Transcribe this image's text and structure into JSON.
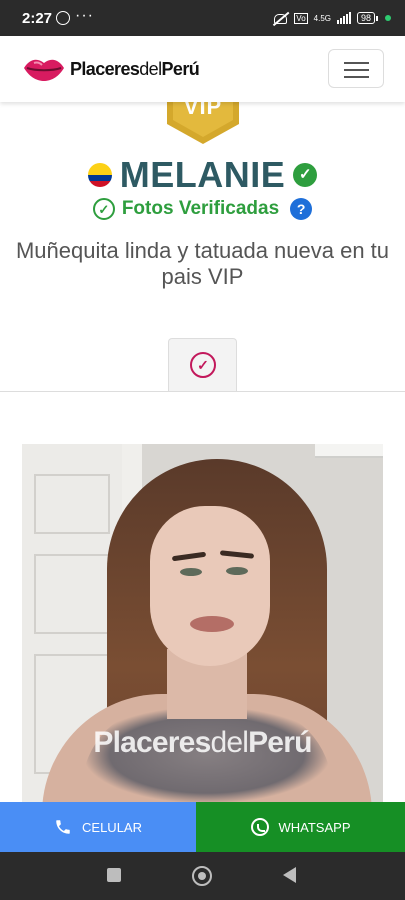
{
  "status_bar": {
    "time": "2:27",
    "network_label": "4.5G",
    "volte_label": "Vo",
    "battery": "98"
  },
  "header": {
    "brand_part1": "Placeres",
    "brand_part2": "del",
    "brand_part3": "Perú",
    "menu_icon": "hamburger-icon"
  },
  "profile": {
    "badge": "VIP",
    "name": "MELANIE",
    "flag_country": "Colombia",
    "flag_colors": [
      "#fcd116",
      "#003893",
      "#ce1126"
    ],
    "verified_label": "Fotos Verificadas",
    "help_symbol": "?",
    "description": "Muñequita linda y tatuada nueva en tu pais VIP"
  },
  "tabs": [
    {
      "icon": "check-circle-icon",
      "active": true
    }
  ],
  "photo": {
    "watermark_part1": "Placeres",
    "watermark_part2": "del",
    "watermark_part3": "Perú"
  },
  "actions": {
    "call_label": "CELULAR",
    "whatsapp_label": "WHATSAPP",
    "call_color": "#4a8ef5",
    "whatsapp_color": "#168f25"
  },
  "nav_bar": {
    "buttons": [
      "recents-icon",
      "home-icon",
      "back-icon"
    ]
  }
}
